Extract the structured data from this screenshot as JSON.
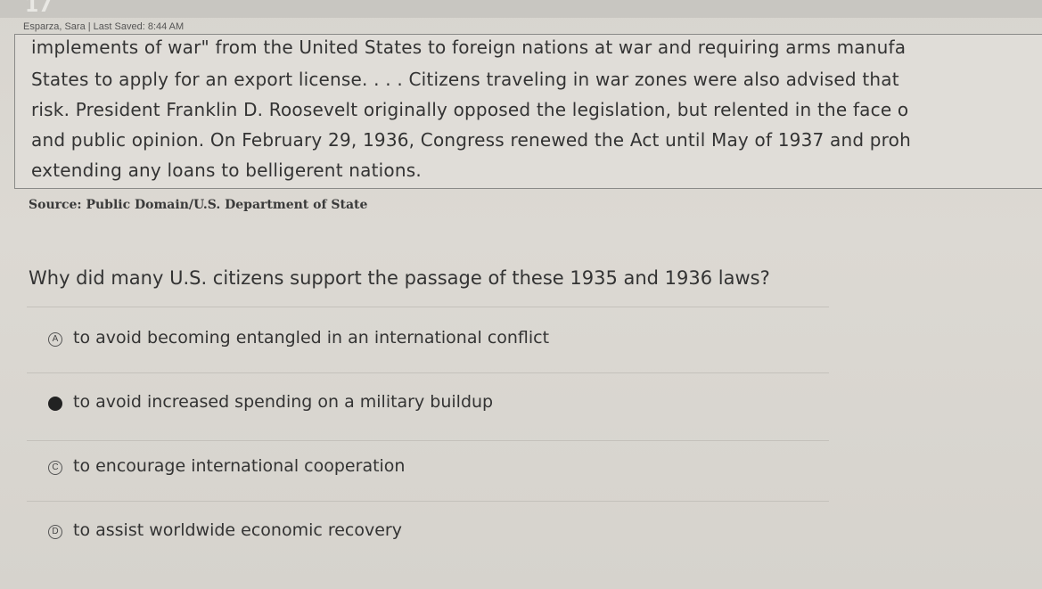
{
  "header": {
    "question_number": "17",
    "meta": "Esparza, Sara | Last Saved: 8:44 AM"
  },
  "passage": {
    "lines": [
      "implements of war\" from the United States to foreign nations at war and requiring arms manufa",
      "States to apply for an export license. . . . Citizens traveling in war zones were also advised that",
      "risk. President Franklin D. Roosevelt originally opposed the legislation, but relented in the face o",
      "and public opinion. On February 29, 1936, Congress renewed the Act until May of 1937 and proh",
      "extending any loans to belligerent nations."
    ]
  },
  "source": "Source: Public Domain/U.S. Department of State",
  "question": "Why did many U.S. citizens support the passage of these 1935 and 1936 laws?",
  "options": [
    {
      "letter": "A",
      "text": "to avoid becoming entangled in an international conflict",
      "selected": false
    },
    {
      "letter": "B",
      "text": "to avoid increased spending on a military buildup",
      "selected": true
    },
    {
      "letter": "C",
      "text": "to encourage international cooperation",
      "selected": false
    },
    {
      "letter": "D",
      "text": "to assist worldwide economic recovery",
      "selected": false
    }
  ]
}
